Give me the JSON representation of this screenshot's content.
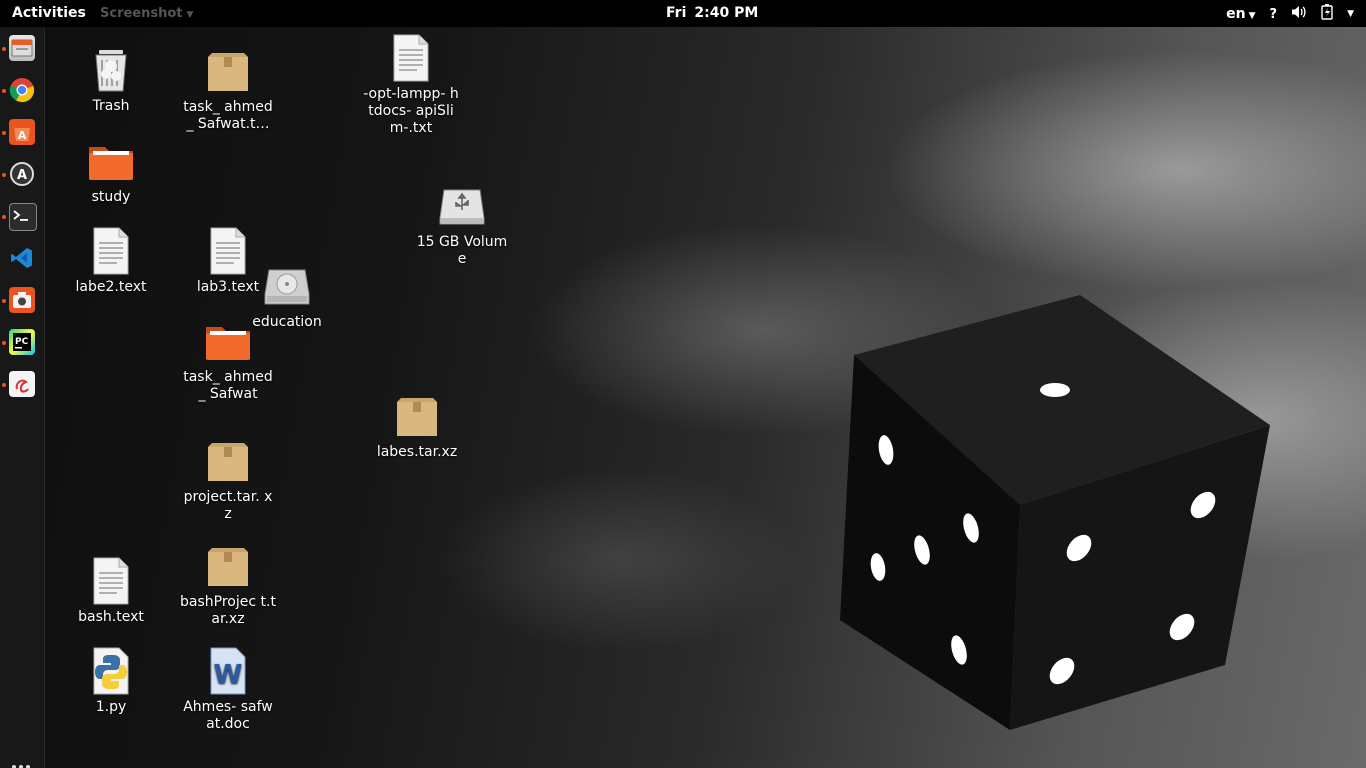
{
  "topbar": {
    "activities": "Activities",
    "app_menu": "Screenshot",
    "day": "Fri",
    "time": "2:40 PM",
    "language": "en",
    "help": "?"
  },
  "dock": {
    "items": [
      {
        "icon": "files-icon",
        "active": true
      },
      {
        "icon": "chrome-icon",
        "active": true
      },
      {
        "icon": "software-center-icon",
        "active": true
      },
      {
        "icon": "software-updater-icon",
        "active": true
      },
      {
        "icon": "terminal-icon",
        "active": true
      },
      {
        "icon": "vscode-icon",
        "active": false
      },
      {
        "icon": "screenshot-icon",
        "active": true
      },
      {
        "icon": "pycharm-icon",
        "active": true
      },
      {
        "icon": "evince-icon",
        "active": true
      }
    ],
    "show_apps_icon": "apps-grid-icon"
  },
  "desktop": {
    "icons": [
      {
        "label": "Trash",
        "type": "trash"
      },
      {
        "label": "study",
        "type": "folder"
      },
      {
        "label": "labe2.text",
        "type": "text"
      },
      {
        "label": "bash.text",
        "type": "text"
      },
      {
        "label": "1.py",
        "type": "python"
      },
      {
        "label": "task_ ahmed_ Safwat.t…",
        "type": "archive"
      },
      {
        "label": "lab3.text",
        "type": "text"
      },
      {
        "label": "task_ ahmed_ Safwat",
        "type": "folder"
      },
      {
        "label": "project.tar. xz",
        "type": "archive"
      },
      {
        "label": "bashProjec t.tar.xz",
        "type": "archive"
      },
      {
        "label": "Ahmes- safwat.doc",
        "type": "word"
      },
      {
        "label": "education",
        "type": "drive"
      },
      {
        "label": "-opt-lampp- htdocs- apiSlim-.txt",
        "type": "text"
      },
      {
        "label": "15 GB Volume",
        "type": "usb"
      },
      {
        "label": "labes.tar.xz",
        "type": "archive"
      }
    ]
  }
}
